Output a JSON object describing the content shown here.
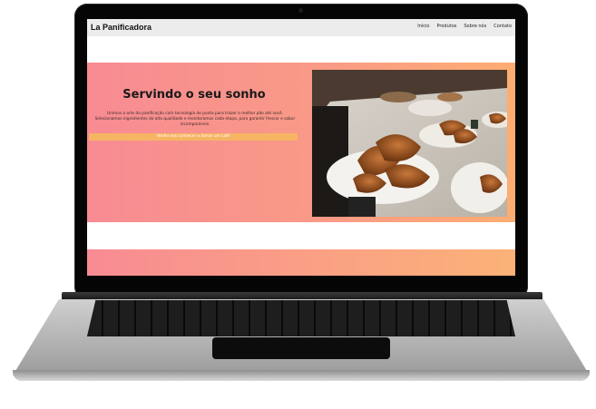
{
  "site": {
    "logo": "La Panificadora",
    "nav": [
      "Início",
      "Produtos",
      "Sobre nós",
      "Contato"
    ]
  },
  "hero": {
    "title": "Servindo o seu sonho",
    "text": "Unimos a arte da panificação com tecnologia de ponta para trazer o melhor pão até você. Selecionamos ingredientes de alta qualidade e monitoramos cada etapa, para garantir frescor e sabor incomparáveis.",
    "cta": "Venha nos conhecer e tomar um café",
    "image_alt": "croissants-pastry-photo"
  },
  "colors": {
    "gradient_start": "#f88b93",
    "gradient_end": "#fdad72",
    "cta_bar": "#f6b563",
    "nav_bg": "#ececec"
  }
}
